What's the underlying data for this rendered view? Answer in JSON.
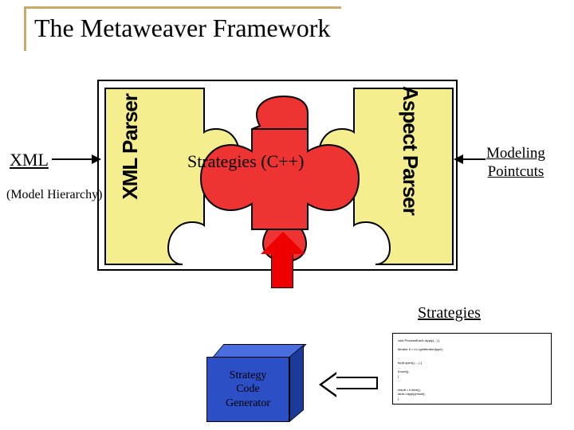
{
  "title": "The Metaweaver Framework",
  "labels": {
    "xml": "XML",
    "model_hierarchy": "(Model Hierarchy)",
    "modeling_pointcuts": "Modeling\nPointcuts",
    "xml_parser": "XML Parser",
    "aspect_parser": "Aspect Parser",
    "strategies_center": "Strategies (C++)",
    "strategies_right": "Strategies",
    "cube": "Strategy\nCode\nGenerator"
  },
  "colors": {
    "title_accent": "#c9a96a",
    "puzzle_yellow": "#f4ee8f",
    "puzzle_red": "#e33",
    "arrow_red": "#e00",
    "cube_blue": "#2d4fc5"
  },
  "code_snippet": "void ProcessEach::apply(...) {\n\n  Iterator it = m->getIterator(type);\n\n  ...\n  for(it.open(); ...) {\n     ...\n     it.next();\n  }\n  ...\n\n  result = it.item();\n  strat->apply(result);\n}"
}
